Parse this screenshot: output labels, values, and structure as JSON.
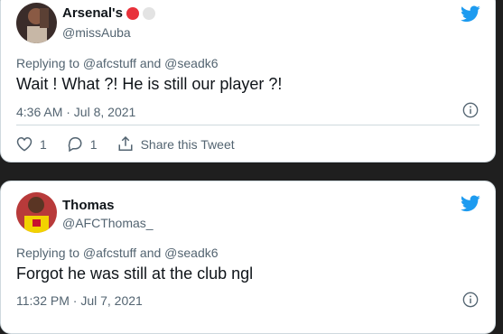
{
  "tweets": [
    {
      "name": "Arsenal's",
      "handle": "@missAuba",
      "replying": "Replying to @afcstuff and @seadk6",
      "text": "Wait ! What ?! He is still our player ?!",
      "time": "4:36 AM · Jul 8, 2021",
      "likes": "1",
      "replies": "1",
      "share_label": "Share this Tweet",
      "badges": [
        "#e8313a",
        "#e3e3e3"
      ]
    },
    {
      "name": "Thomas",
      "handle": "@AFCThomas_",
      "replying": "Replying to @afcstuff and @seadk6",
      "text": "Forgot he was still at the club ngl",
      "time": "11:32 PM · Jul 7, 2021"
    }
  ],
  "colors": {
    "twitter_blue": "#1d9bf0",
    "text_primary": "#0f1419",
    "text_secondary": "#536471"
  },
  "icons": [
    "twitter-bird-icon",
    "info-icon",
    "heart-icon",
    "reply-icon",
    "share-icon"
  ]
}
